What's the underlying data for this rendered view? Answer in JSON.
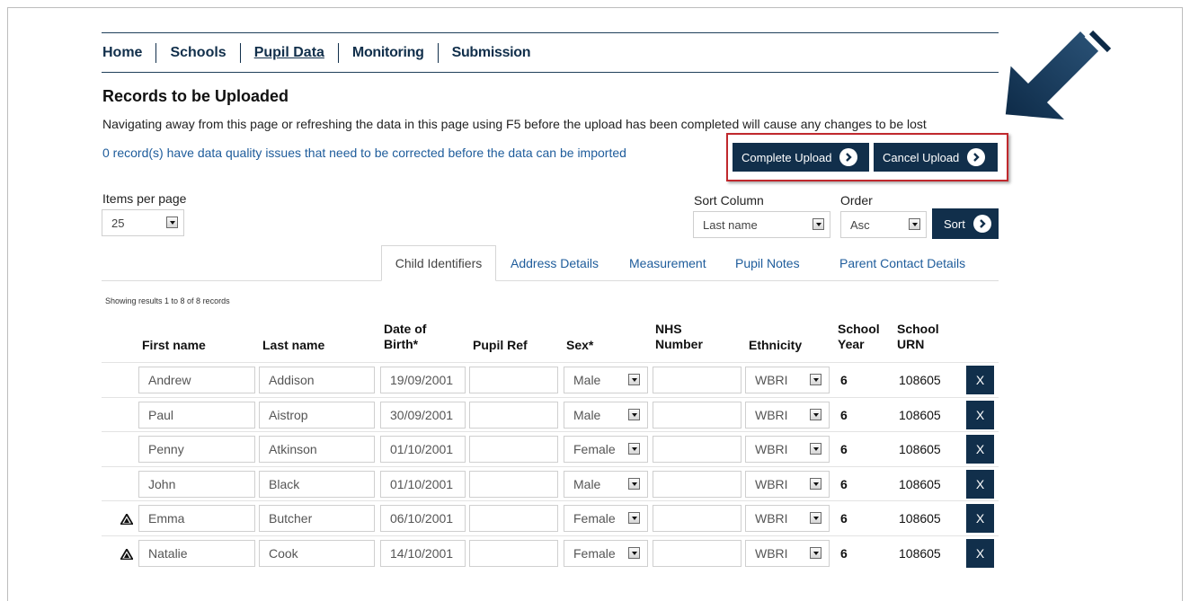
{
  "nav": {
    "items": [
      {
        "label": "Home"
      },
      {
        "label": "Schools"
      },
      {
        "label": "Pupil Data"
      },
      {
        "label": "Monitoring"
      },
      {
        "label": "Submission"
      }
    ]
  },
  "header": {
    "title": "Records to be Uploaded",
    "warning": "Navigating away from this page or refreshing the data in this page using F5 before the upload has been completed will cause any changes to be lost",
    "quality_notice": "0 record(s) have data quality issues that need to be corrected before the data can be imported"
  },
  "actions": {
    "complete_upload": "Complete Upload",
    "cancel_upload": "Cancel Upload"
  },
  "controls": {
    "items_per_page_label": "Items per page",
    "items_per_page_value": "25",
    "sort_column_label": "Sort Column",
    "sort_column_value": "Last name",
    "order_label": "Order",
    "order_value": "Asc",
    "sort_button": "Sort"
  },
  "tabs": [
    {
      "label": "Child Identifiers",
      "active": true
    },
    {
      "label": "Address Details"
    },
    {
      "label": "Measurement"
    },
    {
      "label": "Pupil Notes"
    },
    {
      "label": "Parent Contact Details"
    }
  ],
  "results_summary": "Showing results 1 to 8 of 8 records",
  "table": {
    "headers": {
      "first_name": "First name",
      "last_name": "Last name",
      "dob_line1": "Date of",
      "dob_line2": "Birth*",
      "pupil_ref": "Pupil Ref",
      "sex": "Sex*",
      "nhs_line1": "NHS",
      "nhs_line2": "Number",
      "ethnicity": "Ethnicity",
      "year_line1": "School",
      "year_line2": "Year",
      "urn_line1": "School",
      "urn_line2": "URN"
    },
    "remove_label": "X",
    "rows": [
      {
        "warning": false,
        "first": "Andrew",
        "last": "Addison",
        "dob": "19/09/2001",
        "ref": "",
        "sex": "Male",
        "nhs": "",
        "ethnicity": "WBRI",
        "year": "6",
        "urn": "108605"
      },
      {
        "warning": false,
        "first": "Paul",
        "last": "Aistrop",
        "dob": "30/09/2001",
        "ref": "",
        "sex": "Male",
        "nhs": "",
        "ethnicity": "WBRI",
        "year": "6",
        "urn": "108605"
      },
      {
        "warning": false,
        "first": "Penny",
        "last": "Atkinson",
        "dob": "01/10/2001",
        "ref": "",
        "sex": "Female",
        "nhs": "",
        "ethnicity": "WBRI",
        "year": "6",
        "urn": "108605"
      },
      {
        "warning": false,
        "first": "John",
        "last": "Black",
        "dob": "01/10/2001",
        "ref": "",
        "sex": "Male",
        "nhs": "",
        "ethnicity": "WBRI",
        "year": "6",
        "urn": "108605"
      },
      {
        "warning": true,
        "first": "Emma",
        "last": "Butcher",
        "dob": "06/10/2001",
        "ref": "",
        "sex": "Female",
        "nhs": "",
        "ethnicity": "WBRI",
        "year": "6",
        "urn": "108605"
      },
      {
        "warning": true,
        "first": "Natalie",
        "last": "Cook",
        "dob": "14/10/2001",
        "ref": "",
        "sex": "Female",
        "nhs": "",
        "ethnicity": "WBRI",
        "year": "6",
        "urn": "108605"
      }
    ]
  },
  "colors": {
    "navy": "#112f4b",
    "link_blue": "#1e5c9b",
    "highlight_red": "#c0282d"
  }
}
